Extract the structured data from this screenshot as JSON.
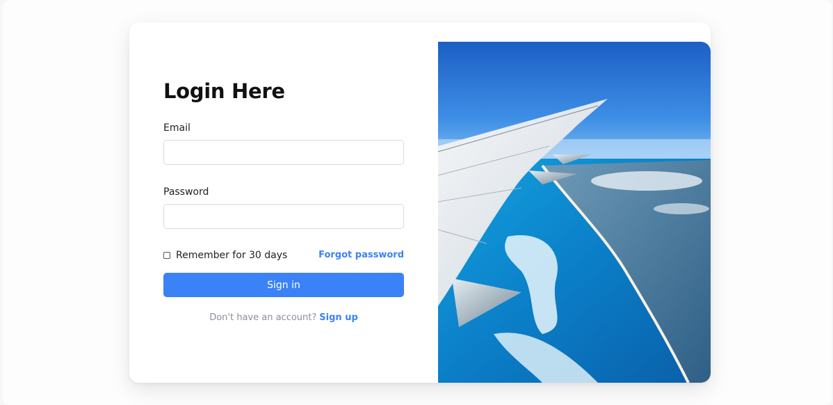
{
  "login": {
    "title": "Login Here",
    "email_label": "Email",
    "email_value": "",
    "password_label": "Password",
    "password_value": "",
    "remember_label": "Remember for 30 days",
    "remember_checked": false,
    "forgot_label": "Forgot password",
    "signin_label": "Sign in",
    "signup_prompt": "Don't have an account?",
    "signup_label": "Sign up"
  },
  "hero": {
    "subject": "airplane wing over coastline"
  },
  "colors": {
    "accent": "#3b82f6",
    "title": "#111111",
    "muted": "#8a8f98",
    "sky": "#1f6fd1",
    "ocean": "#0d7cc7"
  }
}
